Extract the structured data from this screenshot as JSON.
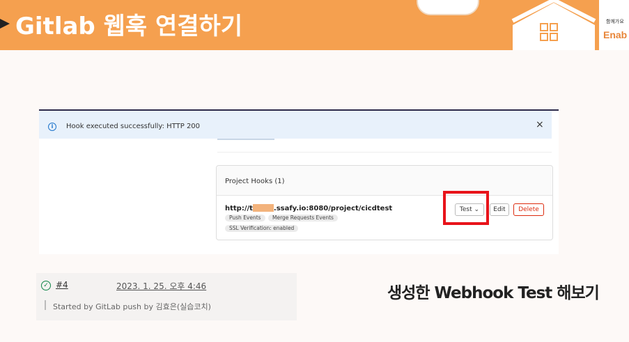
{
  "banner": {
    "title": "Gitlab 웹훅 연결하기",
    "brand_small": "함께가요",
    "brand": "Enab"
  },
  "alert": {
    "message": "Hook executed successfully: HTTP 200",
    "close": "×"
  },
  "hooks": {
    "title": "Project Hooks (1)",
    "url_prefix": "http://t",
    "url_suffix": ".ssafy.io:8080/project/cicdtest",
    "tags": [
      "Push Events",
      "Merge Requests Events",
      "SSL Verification: enabled"
    ],
    "test_label": "Test",
    "edit_label": "Edit",
    "delete_label": "Delete"
  },
  "pipeline": {
    "id": "#4",
    "date": "2023. 1. 25. 오후 4:46",
    "started": "Started by GitLab push by 김효은(실습코치)"
  },
  "caption": "생성한 Webhook Test 해보기",
  "colors": {
    "banner": "#f5a04f",
    "highlight": "#e8131a",
    "delete": "#dd2b0e",
    "success": "#108548"
  }
}
